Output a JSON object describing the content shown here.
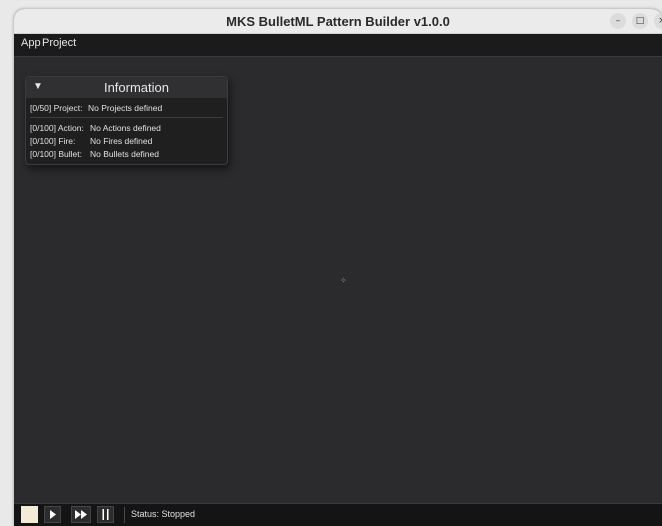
{
  "window": {
    "title": "MKS BulletML Pattern Builder v1.0.0",
    "controls": {
      "minimize": "–",
      "maximize": "□",
      "close": "×"
    }
  },
  "menu": [
    {
      "label": "App"
    },
    {
      "label": "Project"
    }
  ],
  "info_panel": {
    "title": "Information",
    "collapse_icon": "triangle-down-icon",
    "rows": [
      {
        "label": "[0/50] Project:",
        "value": "No Projects defined"
      },
      {
        "label": "[0/100] Action:",
        "value": "No Actions defined"
      },
      {
        "label": "[0/100] Fire:",
        "value": "No Fires defined"
      },
      {
        "label": "[0/100] Bullet:",
        "value": "No Bullets defined"
      }
    ]
  },
  "toolbar": {
    "buttons": [
      "stop-icon",
      "play-icon",
      "fast-forward-icon",
      "pause-icon"
    ],
    "status": "Status: Stopped"
  },
  "colors": {
    "canvas": "#2b2b2d",
    "menubar": "#1b1b1c",
    "panel": "#1f1f20",
    "stop_fill": "#f4ead6"
  }
}
